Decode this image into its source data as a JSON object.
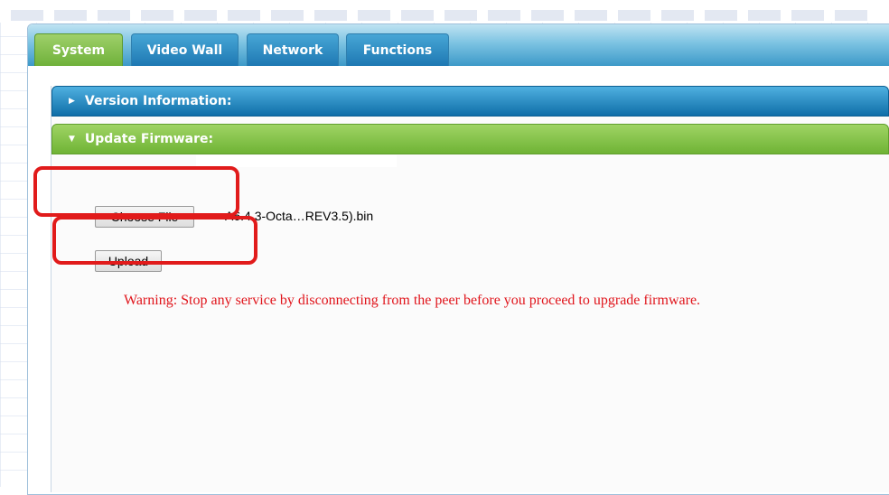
{
  "tabs": [
    {
      "label": "System",
      "active": true
    },
    {
      "label": "Video Wall",
      "active": false
    },
    {
      "label": "Network",
      "active": false
    },
    {
      "label": "Functions",
      "active": false
    }
  ],
  "panels": {
    "version": {
      "title": "Version Information:",
      "expanded": false
    },
    "firmware": {
      "title": "Update Firmware:",
      "expanded": true
    }
  },
  "firmware": {
    "choose_file_label": "Choose File",
    "selected_file": "A6.4.3-Octa…REV3.5).bin",
    "upload_label": "Upload",
    "warning": "Warning: Stop any service by disconnecting from the peer before you proceed to upgrade firmware."
  },
  "colors": {
    "tab_active": "#6fb13a",
    "tab_inactive": "#1e78b3",
    "panel_blue": "#0f6ea8",
    "panel_green": "#6fb335",
    "warning_text": "#e0141b",
    "highlight": "#e11b1b"
  },
  "icons": {
    "collapsed": "caret-right-icon",
    "expanded": "caret-down-icon"
  }
}
